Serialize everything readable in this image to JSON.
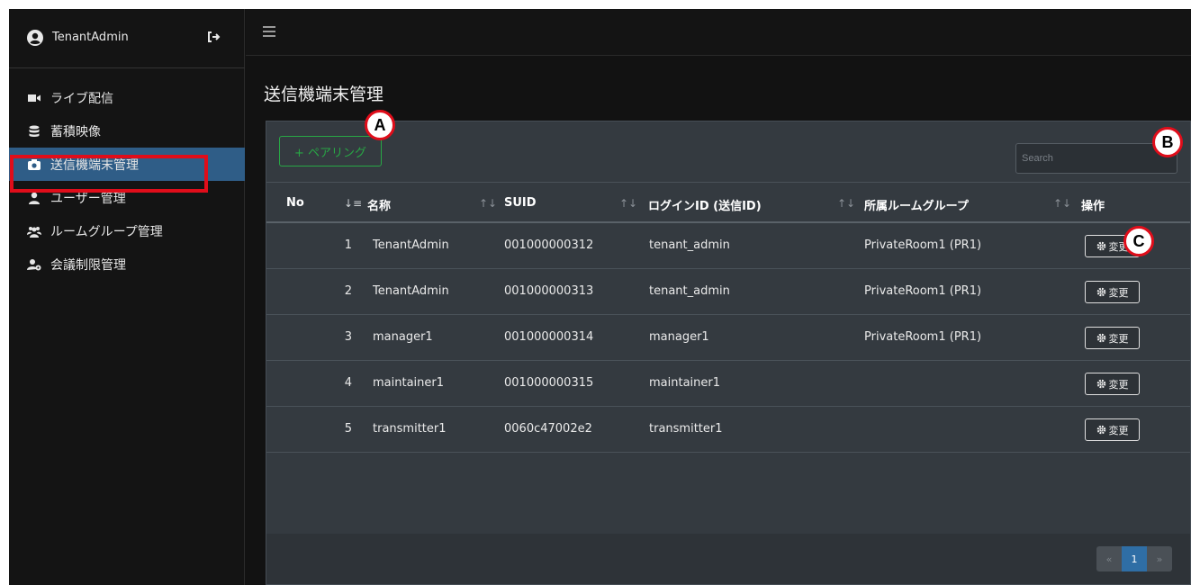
{
  "sidebar": {
    "user_name": "TenantAdmin",
    "items": [
      {
        "label": "ライブ配信",
        "icon": "video-camera-icon"
      },
      {
        "label": "蓄積映像",
        "icon": "database-icon"
      },
      {
        "label": "送信機端末管理",
        "icon": "camera-icon",
        "active": true
      },
      {
        "label": "ユーザー管理",
        "icon": "user-icon"
      },
      {
        "label": "ルームグループ管理",
        "icon": "users-icon"
      },
      {
        "label": "会議制限管理",
        "icon": "user-settings-icon"
      }
    ]
  },
  "page": {
    "title": "送信機端末管理"
  },
  "toolbar": {
    "pairing_label": "+ ペアリング",
    "search_placeholder": "Search"
  },
  "table": {
    "headers": {
      "no": "No",
      "name": "名称",
      "suid": "SUID",
      "login": "ログインID (送信ID)",
      "room": "所属ルームグループ",
      "action": "操作"
    },
    "rows": [
      {
        "no": "1",
        "name": "TenantAdmin",
        "suid": "001000000312",
        "login": "tenant_admin",
        "room": "PrivateRoom1 (PR1)",
        "action": "変更"
      },
      {
        "no": "2",
        "name": "TenantAdmin",
        "suid": "001000000313",
        "login": "tenant_admin",
        "room": "PrivateRoom1 (PR1)",
        "action": "変更"
      },
      {
        "no": "3",
        "name": "manager1",
        "suid": "001000000314",
        "login": "manager1",
        "room": "PrivateRoom1 (PR1)",
        "action": "変更"
      },
      {
        "no": "4",
        "name": "maintainer1",
        "suid": "001000000315",
        "login": "maintainer1",
        "room": "",
        "action": "変更"
      },
      {
        "no": "5",
        "name": "transmitter1",
        "suid": "0060c47002e2",
        "login": "transmitter1",
        "room": "",
        "action": "変更"
      }
    ]
  },
  "pagination": {
    "prev": "«",
    "current": "1",
    "next": "»"
  },
  "markers": {
    "a": "A",
    "b": "B",
    "c": "C"
  },
  "colors": {
    "accent_active": "#2f5d87",
    "pairing_green": "#28a745",
    "highlight_red": "#e00d1a"
  }
}
